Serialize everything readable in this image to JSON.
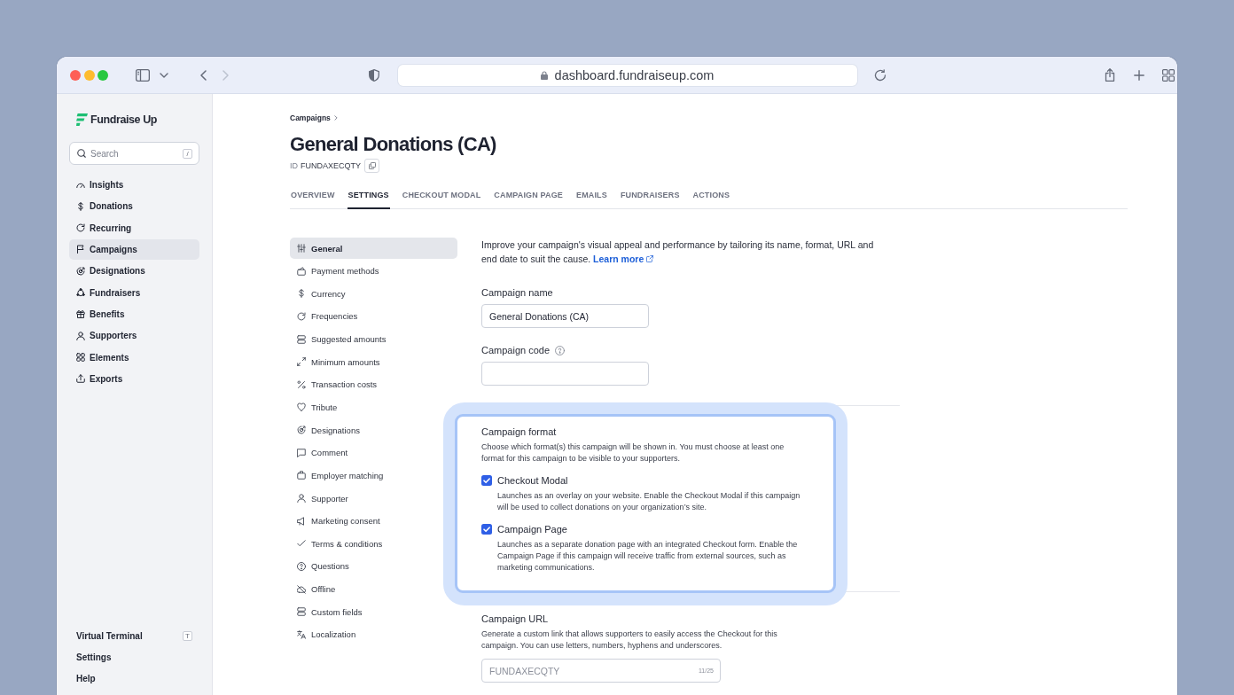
{
  "browser": {
    "url": "dashboard.fundraiseup.com",
    "back_enabled": true,
    "forward_enabled": false
  },
  "sidebar": {
    "brand": "Fundraise Up",
    "search": {
      "placeholder": "Search",
      "shortcut": "/"
    },
    "items": [
      {
        "label": "Insights",
        "selected": false
      },
      {
        "label": "Donations",
        "selected": false
      },
      {
        "label": "Recurring",
        "selected": false
      },
      {
        "label": "Campaigns",
        "selected": true
      },
      {
        "label": "Designations",
        "selected": false
      },
      {
        "label": "Fundraisers",
        "selected": false
      },
      {
        "label": "Benefits",
        "selected": false
      },
      {
        "label": "Supporters",
        "selected": false
      },
      {
        "label": "Elements",
        "selected": false
      },
      {
        "label": "Exports",
        "selected": false
      }
    ],
    "footer_items": [
      {
        "label": "Virtual Terminal",
        "shortcut": "T"
      },
      {
        "label": "Settings"
      },
      {
        "label": "Help"
      }
    ]
  },
  "breadcrumb": [
    {
      "label": "Campaigns"
    }
  ],
  "page": {
    "title": "General Donations (CA)",
    "id_label": "ID",
    "id_value": "FUNDAXECQTY"
  },
  "tabs": [
    {
      "label": "OVERVIEW",
      "selected": false
    },
    {
      "label": "SETTINGS",
      "selected": true
    },
    {
      "label": "CHECKOUT MODAL",
      "selected": false
    },
    {
      "label": "CAMPAIGN PAGE",
      "selected": false
    },
    {
      "label": "EMAILS",
      "selected": false
    },
    {
      "label": "FUNDRAISERS",
      "selected": false
    },
    {
      "label": "ACTIONS",
      "selected": false
    }
  ],
  "settings_nav": [
    {
      "label": "General",
      "selected": true
    },
    {
      "label": "Payment methods",
      "selected": false
    },
    {
      "label": "Currency",
      "selected": false
    },
    {
      "label": "Frequencies",
      "selected": false
    },
    {
      "label": "Suggested amounts",
      "selected": false
    },
    {
      "label": "Minimum amounts",
      "selected": false
    },
    {
      "label": "Transaction costs",
      "selected": false
    },
    {
      "label": "Tribute",
      "selected": false
    },
    {
      "label": "Designations",
      "selected": false
    },
    {
      "label": "Comment",
      "selected": false
    },
    {
      "label": "Employer matching",
      "selected": false
    },
    {
      "label": "Supporter",
      "selected": false
    },
    {
      "label": "Marketing consent",
      "selected": false
    },
    {
      "label": "Terms & conditions",
      "selected": false
    },
    {
      "label": "Questions",
      "selected": false
    },
    {
      "label": "Offline",
      "selected": false
    },
    {
      "label": "Custom fields",
      "selected": false
    },
    {
      "label": "Localization",
      "selected": false
    }
  ],
  "general": {
    "intro": "Improve your campaign's visual appeal and performance by tailoring its name, format, URL and end date to suit the cause.",
    "learn_more": "Learn more",
    "campaign_name": {
      "label": "Campaign name",
      "value": "General Donations (CA)"
    },
    "campaign_code": {
      "label": "Campaign code"
    },
    "format": {
      "highlighted": true,
      "label": "Campaign format",
      "description": "Choose which format(s) this campaign will be shown in. You must choose at least one format for this campaign to be visible to your supporters.",
      "options": [
        {
          "label": "Checkout Modal",
          "checked": true,
          "description": "Launches as an overlay on your website. Enable the Checkout Modal if this campaign will be used to collect donations on your organization’s site."
        },
        {
          "label": "Campaign Page",
          "checked": true,
          "description": "Launches as a separate donation page with an integrated Checkout form. Enable the Campaign Page if this campaign will receive traffic from external sources, such as marketing communications."
        }
      ]
    },
    "campaign_url": {
      "label": "Campaign URL",
      "description": "Generate a custom link that allows supporters to easily access the Checkout for this campaign. You can use letters, numbers, hyphens and underscores.",
      "placeholder": "FUNDAXECQTY",
      "counter": "11/25"
    }
  }
}
